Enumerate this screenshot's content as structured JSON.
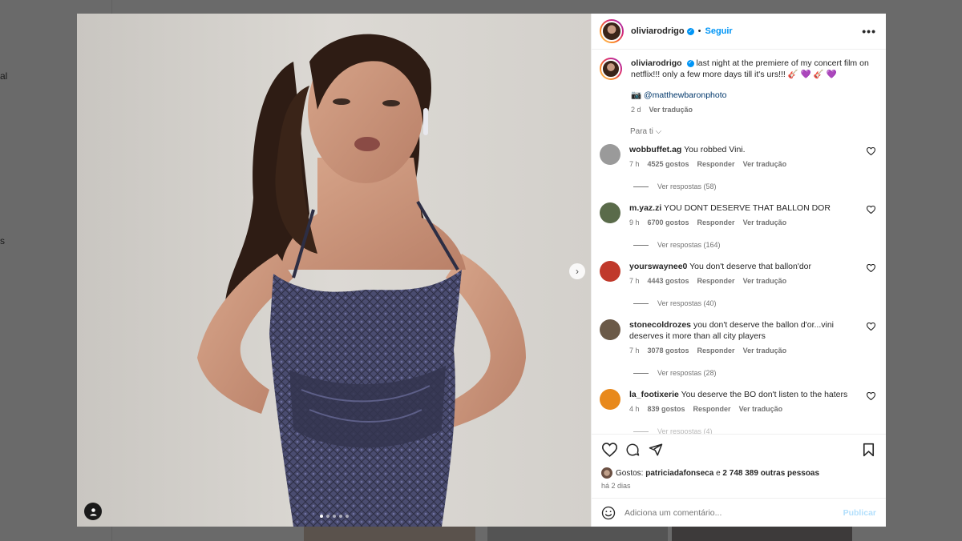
{
  "background": {
    "side_texts": [
      "al",
      "s"
    ]
  },
  "post": {
    "author": "oliviarodrigo",
    "follow_label": "Seguir",
    "separator": "•",
    "more_label": "•••",
    "carousel": {
      "current": 1,
      "total": 5
    },
    "caption": {
      "username": "oliviarodrigo",
      "text": "last night at the premiere of my concert film on netflix!!! only a few more days till it's urs!!! 🎸 💜 🎸 💜",
      "credit": "📷 @matthewbaronphoto",
      "time": "2 d",
      "translate": "Ver tradução"
    },
    "filter_label": "Para ti ⌵",
    "comments": [
      {
        "username": "wobbuffet.ag",
        "text": "You robbed Vini.",
        "time": "7 h",
        "likes": "4525 gostos",
        "reply": "Responder",
        "translate": "Ver tradução",
        "replies": "Ver respostas (58)",
        "avatar_color": "#9a9a9a"
      },
      {
        "username": "m.yaz.zi",
        "text": "YOU DONT DESERVE THAT BALLON DOR",
        "time": "9 h",
        "likes": "6700 gostos",
        "reply": "Responder",
        "translate": "Ver tradução",
        "replies": "Ver respostas (164)",
        "avatar_color": "#5a6b4a"
      },
      {
        "username": "yourswaynee0",
        "text": "You don't deserve that ballon'dor",
        "time": "7 h",
        "likes": "4443 gostos",
        "reply": "Responder",
        "translate": "Ver tradução",
        "replies": "Ver respostas (40)",
        "avatar_color": "#c0392b"
      },
      {
        "username": "stonecoldrozes",
        "text": "you don't deserve the ballon d'or...vini deserves it more than all city players",
        "time": "7 h",
        "likes": "3078 gostos",
        "reply": "Responder",
        "translate": "Ver tradução",
        "replies": "Ver respostas (28)",
        "avatar_color": "#6b5a48"
      },
      {
        "username": "la_footixerie",
        "text": "You deserve the BO don't listen to the haters",
        "time": "4 h",
        "likes": "839 gostos",
        "reply": "Responder",
        "translate": "Ver tradução",
        "replies": "Ver respostas (4)",
        "avatar_color": "#e8891c"
      }
    ],
    "likes": {
      "prefix": "Gostos:",
      "first_user": "patriciadafonseca",
      "conj": "e",
      "others": "2 748 389 outras pessoas"
    },
    "date": "há 2 dias",
    "comment_placeholder": "Adiciona um comentário...",
    "publish_label": "Publicar"
  },
  "colors": {
    "accent": "#0095f6",
    "text": "#262626",
    "muted": "#737373",
    "dress": "#3d3f5e"
  }
}
